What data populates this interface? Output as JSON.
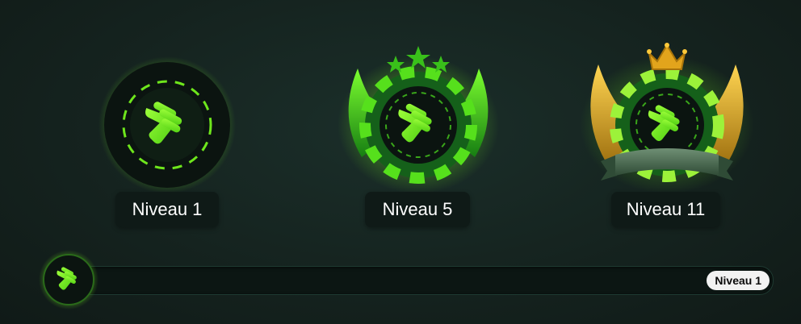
{
  "colors": {
    "accent": "#6ee61c",
    "accent_dark": "#1b7a10",
    "gold": "#d9a520",
    "background": "#15231f"
  },
  "badges": [
    {
      "level_label": "Niveau 1",
      "icon": "hand-swipe-chip-icon",
      "decoration": "none"
    },
    {
      "level_label": "Niveau 5",
      "icon": "hand-swipe-chip-icon",
      "decoration": "green-wings-three-stars"
    },
    {
      "level_label": "Niveau 11",
      "icon": "hand-swipe-chip-icon",
      "decoration": "golden-wings-crown-ribbon"
    }
  ],
  "progress": {
    "current_level_label": "Niveau 1",
    "fill_fraction": 0
  }
}
